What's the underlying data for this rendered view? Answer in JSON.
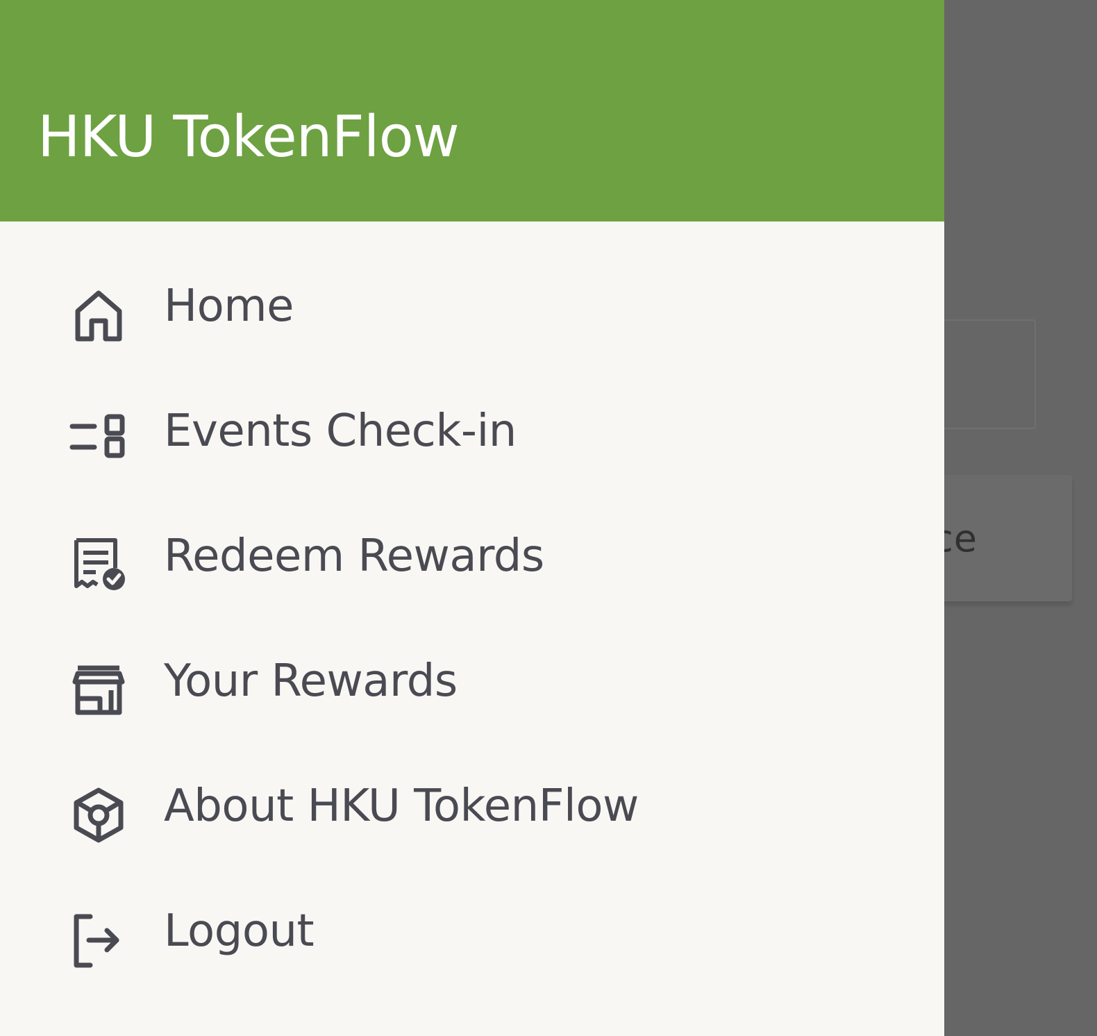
{
  "app": {
    "title": "HKU TokenFlow",
    "accent_color": "#6ea142",
    "drawer_background": "#f8f7f4",
    "text_color": "#4a4a52"
  },
  "drawer": {
    "items": [
      {
        "label": "Home",
        "icon": "home-icon"
      },
      {
        "label": "Events Check-in",
        "icon": "event-checkin-icon"
      },
      {
        "label": "Redeem Rewards",
        "icon": "receipt-check-icon"
      },
      {
        "label": "Your Rewards",
        "icon": "store-icon"
      },
      {
        "label": "About HKU TokenFlow",
        "icon": "cube-icon"
      },
      {
        "label": "Logout",
        "icon": "logout-icon"
      }
    ]
  },
  "background": {
    "button_partial_text": "ce"
  }
}
